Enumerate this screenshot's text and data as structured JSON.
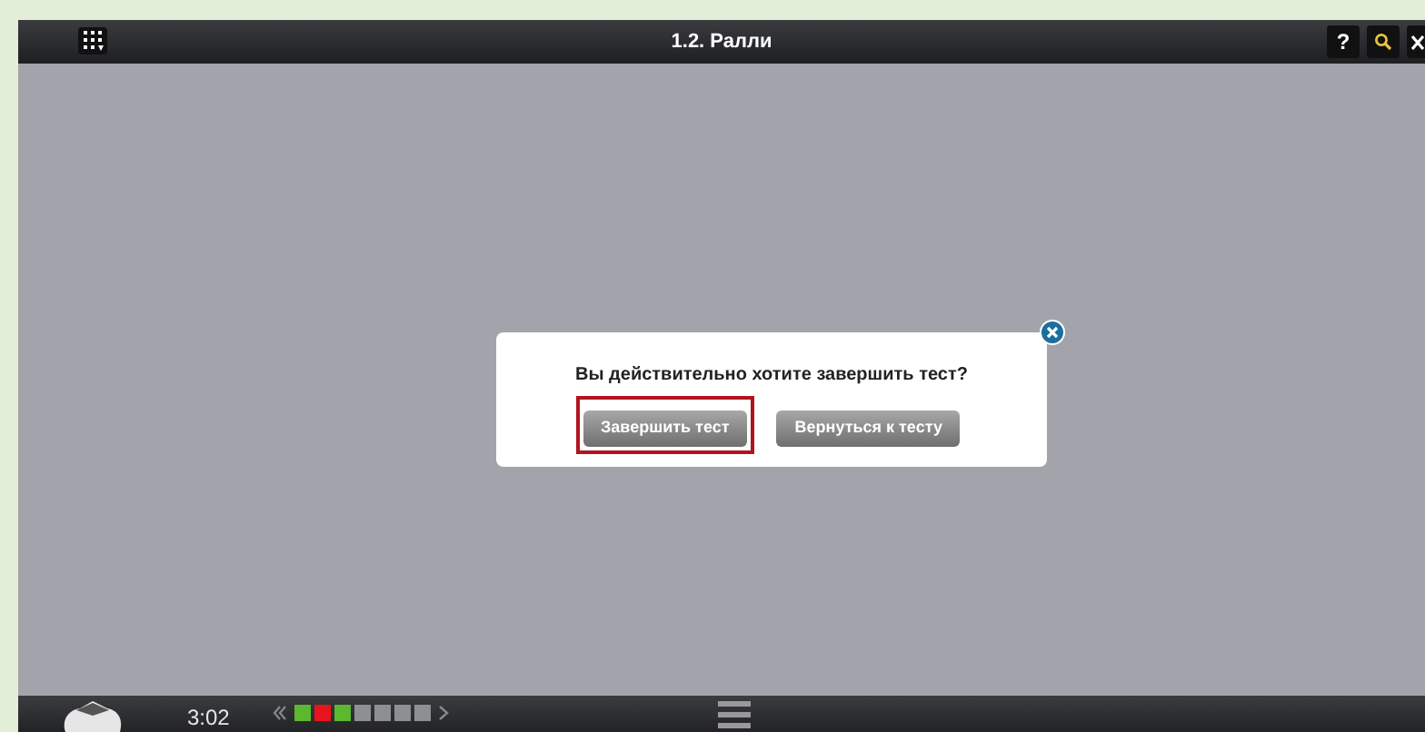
{
  "header": {
    "title": "1.2. Ралли",
    "help": "?"
  },
  "dialog": {
    "message": "Вы действительно хотите завершить тест?",
    "buttons": [
      {
        "label": "Завершить тест",
        "highlighted": true
      },
      {
        "label": "Вернуться к тесту",
        "highlighted": false
      }
    ]
  },
  "footer": {
    "timer": "3:02",
    "progress": [
      {
        "color": "#5cb82e"
      },
      {
        "color": "#e8141c"
      },
      {
        "color": "#5cb82e"
      },
      {
        "color": "#8e8f93"
      },
      {
        "color": "#8e8f93"
      },
      {
        "color": "#8e8f93"
      },
      {
        "color": "#8e8f93"
      }
    ]
  }
}
